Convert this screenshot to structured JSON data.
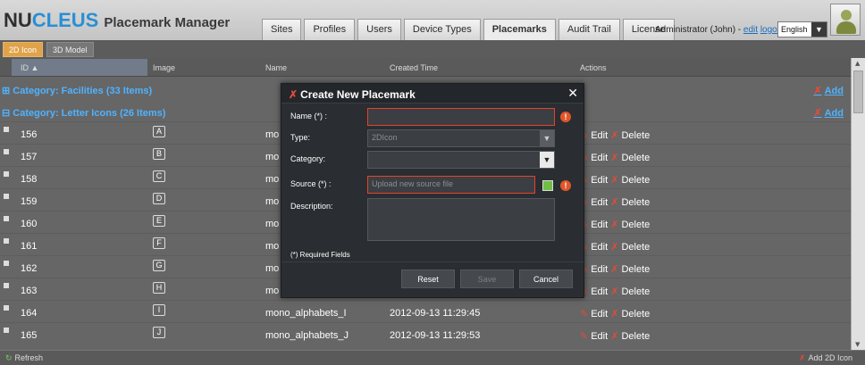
{
  "app": {
    "logo_nu": "NU",
    "logo_cleus": "CLEUS",
    "title": "Placemark Manager"
  },
  "nav": {
    "tabs": [
      {
        "label": "Sites"
      },
      {
        "label": "Profiles"
      },
      {
        "label": "Users"
      },
      {
        "label": "Device Types"
      },
      {
        "label": "Placemarks",
        "active": true
      },
      {
        "label": "Audit Trail"
      },
      {
        "label": "License"
      }
    ]
  },
  "user": {
    "prefix": "Administrator (John) - ",
    "edit": "edit",
    "logout": "logout",
    "language": "English"
  },
  "subtabs": {
    "icon2d": "2D Icon",
    "model3d": "3D Model"
  },
  "columns": {
    "id": "ID ▲",
    "image": "Image",
    "name": "Name",
    "created": "Created Time",
    "actions": "Actions"
  },
  "categories": {
    "facilities": "Category: Facilities (33 Items)",
    "letters": "Category: Letter Icons (26 Items)",
    "add": "Add"
  },
  "rows": [
    {
      "id": "156",
      "img": "A",
      "name": "mo",
      "time": ""
    },
    {
      "id": "157",
      "img": "B",
      "name": "mo",
      "time": ""
    },
    {
      "id": "158",
      "img": "C",
      "name": "mo",
      "time": ""
    },
    {
      "id": "159",
      "img": "D",
      "name": "mo",
      "time": ""
    },
    {
      "id": "160",
      "img": "E",
      "name": "mo",
      "time": ""
    },
    {
      "id": "161",
      "img": "F",
      "name": "mo",
      "time": ""
    },
    {
      "id": "162",
      "img": "G",
      "name": "mo",
      "time": ""
    },
    {
      "id": "163",
      "img": "H",
      "name": "mo",
      "time": ""
    },
    {
      "id": "164",
      "img": "I",
      "name": "mono_alphabets_I",
      "time": "2012-09-13 11:29:45"
    },
    {
      "id": "165",
      "img": "J",
      "name": "mono_alphabets_J",
      "time": "2012-09-13 11:29:53"
    }
  ],
  "row_actions": {
    "edit": "Edit",
    "delete": "Delete"
  },
  "footer": {
    "refresh": "Refresh",
    "add": "Add 2D Icon"
  },
  "modal": {
    "title": "Create New Placemark",
    "name_label": "Name (*) :",
    "name_value": "",
    "type_label": "Type:",
    "type_value": "2DIcon",
    "category_label": "Category:",
    "category_value": "",
    "source_label": "Source (*) :",
    "source_placeholder": "Upload new source file",
    "description_label": "Description:",
    "required_note": "(*) Required Fields",
    "reset": "Reset",
    "save": "Save",
    "cancel": "Cancel"
  },
  "colors": {
    "accent_blue": "#4fb3ff",
    "error_red": "#e5432c",
    "subtab_active": "#e0a34a"
  }
}
